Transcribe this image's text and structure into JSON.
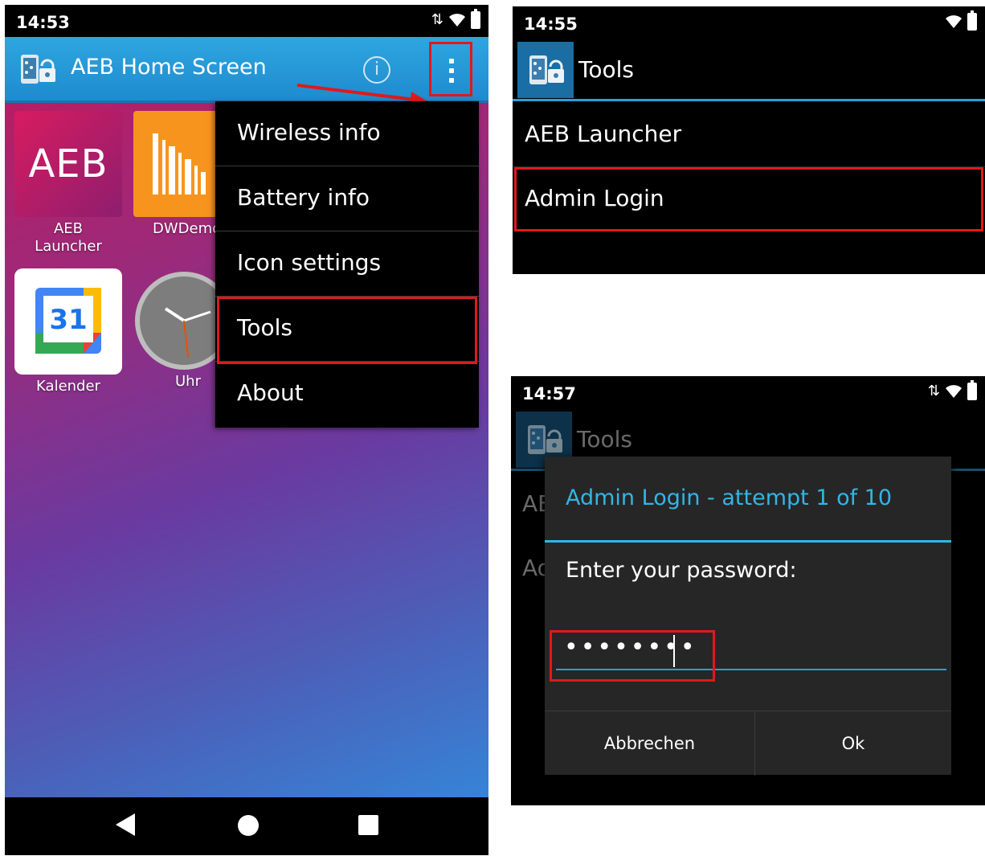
{
  "left": {
    "status": {
      "time": "14:53"
    },
    "appbar": {
      "title": "AEB Home Screen",
      "info_glyph": "i"
    },
    "apps": [
      {
        "label": "AEB\nLauncher",
        "tile_text": "AEB"
      },
      {
        "label": "DWDemo"
      },
      {
        "label": "Kalender",
        "tile_text": "31"
      },
      {
        "label": "Uhr"
      }
    ],
    "menu": [
      {
        "label": "Wireless info"
      },
      {
        "label": "Battery info"
      },
      {
        "label": "Icon settings"
      },
      {
        "label": "Tools"
      },
      {
        "label": "About"
      }
    ]
  },
  "tools": {
    "status": {
      "time": "14:55"
    },
    "title": "Tools",
    "items": [
      {
        "label": "AEB Launcher"
      },
      {
        "label": "Admin Login"
      }
    ]
  },
  "login": {
    "status": {
      "time": "14:57"
    },
    "background_title": "Tools",
    "background_items": [
      "AE",
      "Ad"
    ],
    "dialog": {
      "title": "Admin Login - attempt 1 of 10",
      "prompt": "Enter your password:",
      "password_mask": "••••••••",
      "cancel_label": "Abbrechen",
      "ok_label": "Ok"
    }
  },
  "colors": {
    "accent": "#33b5e5",
    "highlight": "#e0191b",
    "appbar": "#1e8bcf"
  }
}
